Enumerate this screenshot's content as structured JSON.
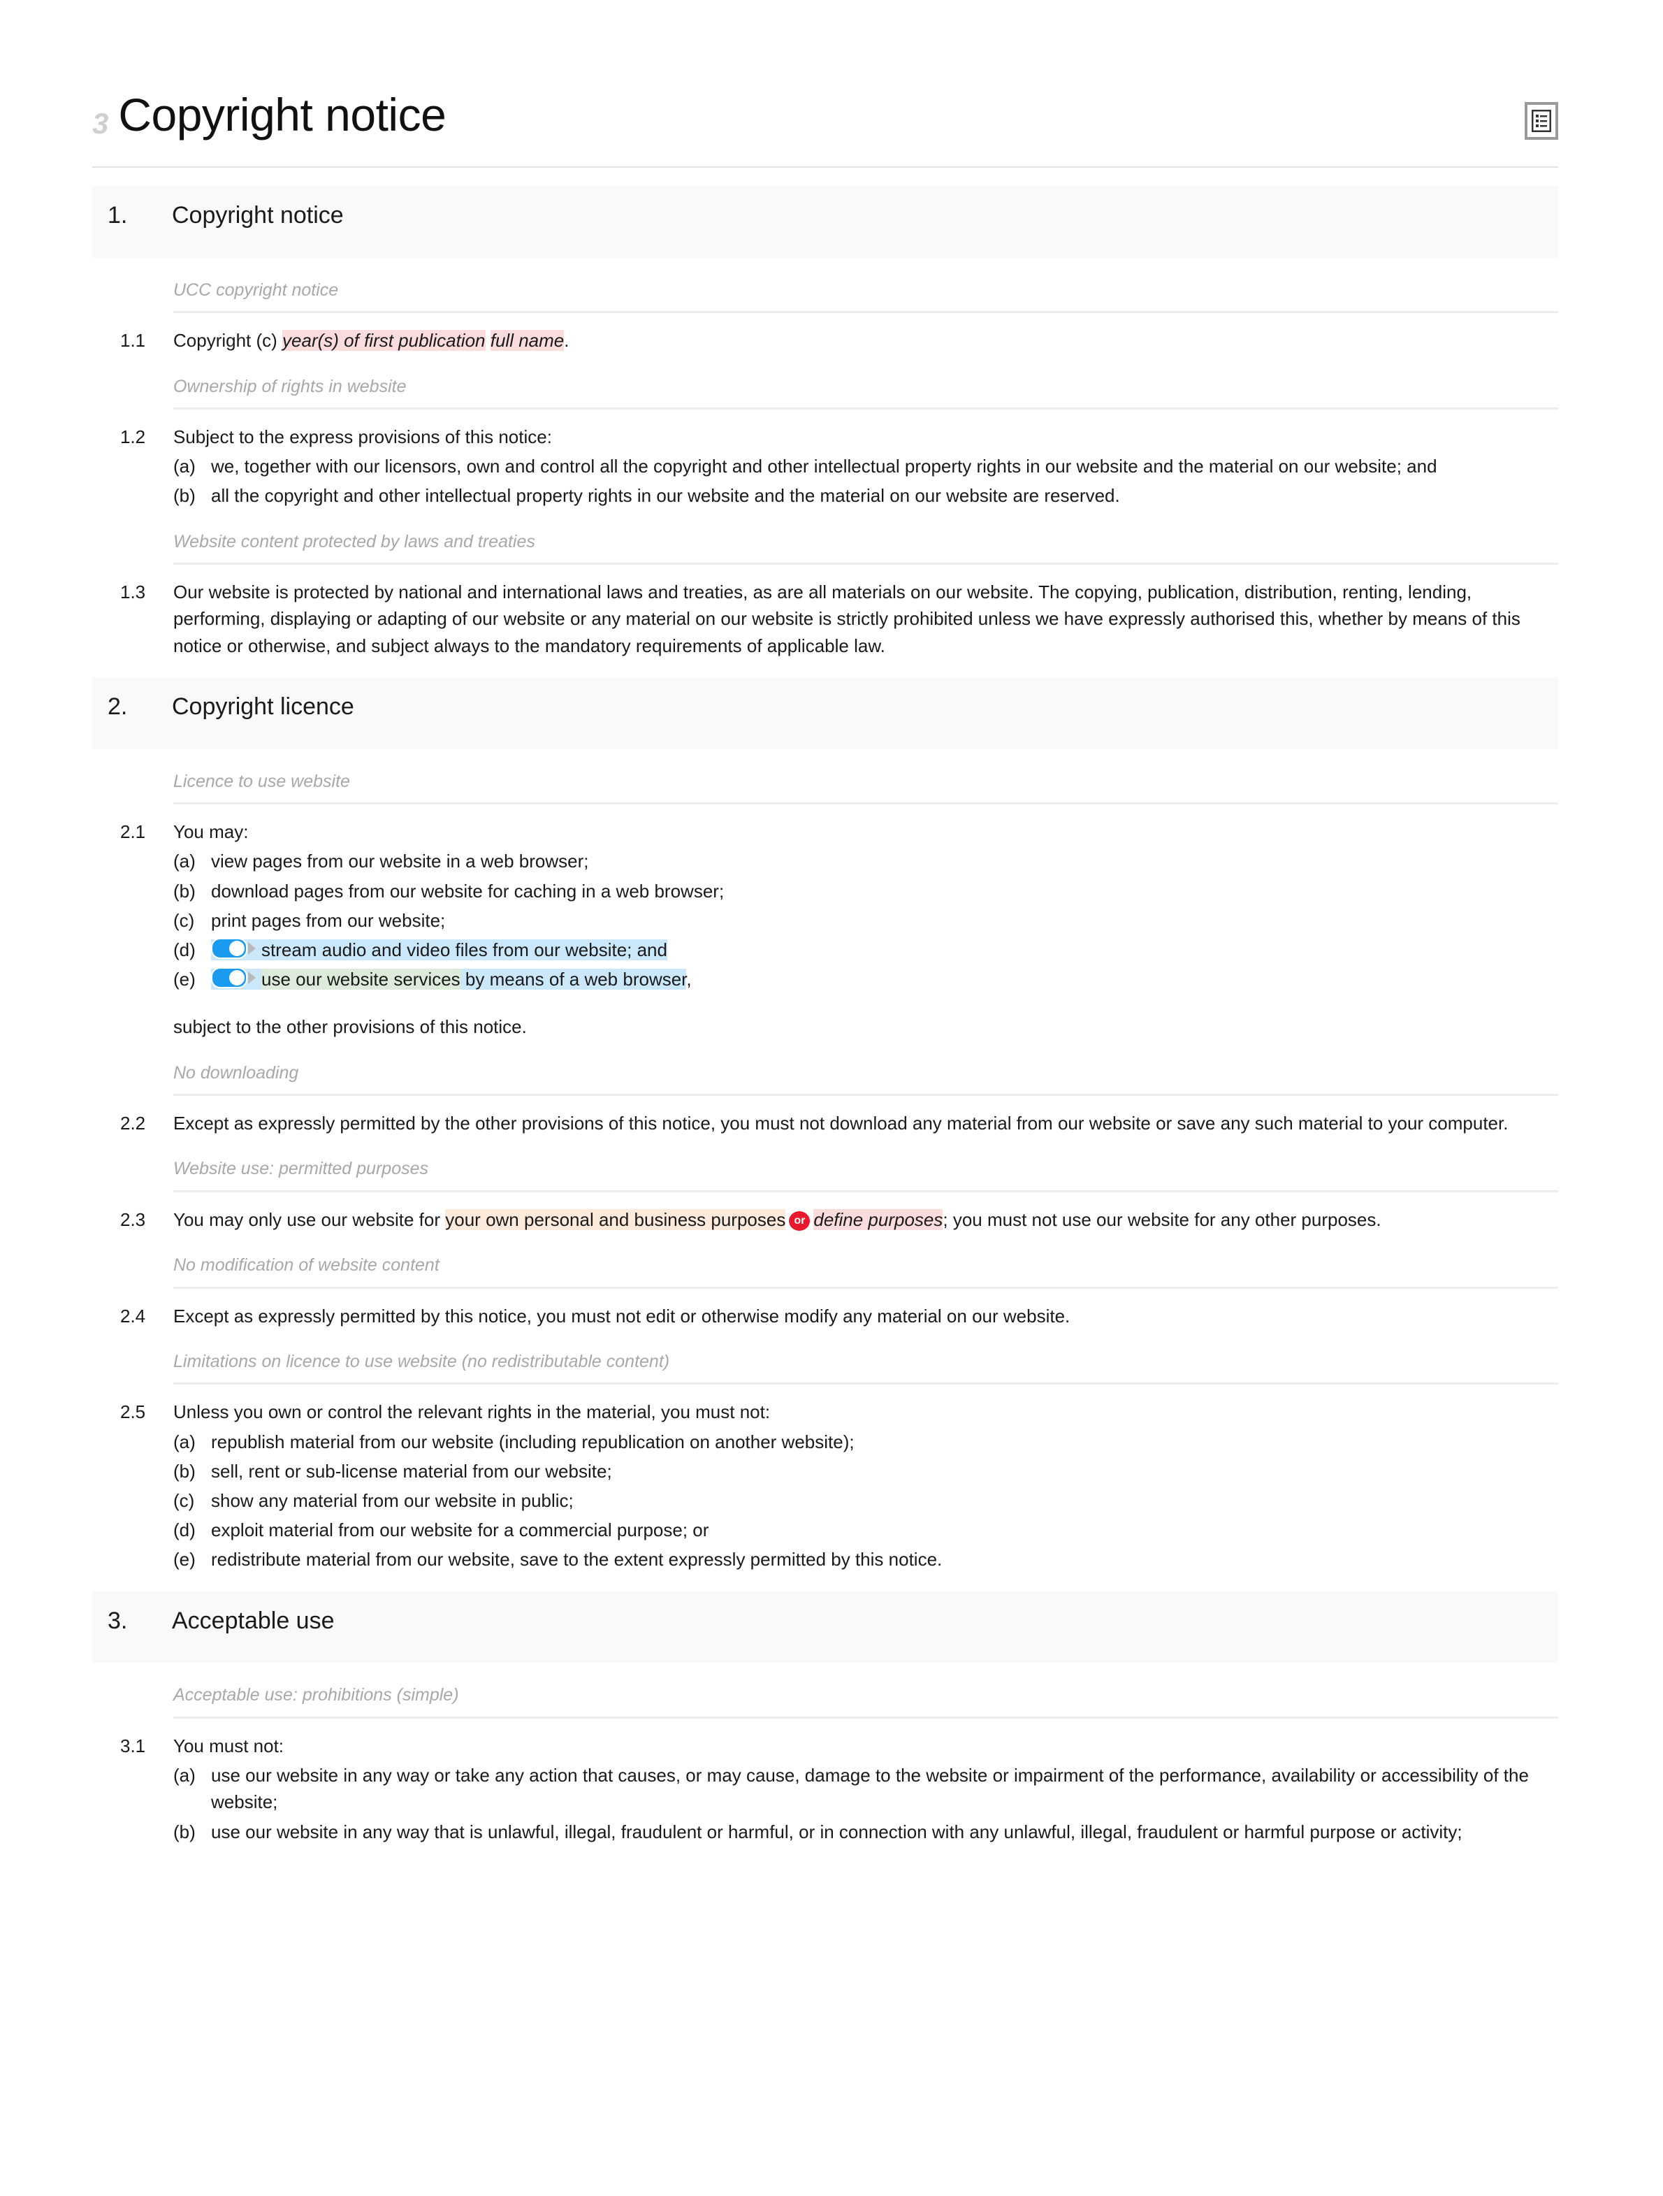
{
  "document": {
    "title": "Copyright notice",
    "doc_mark": "3",
    "header_icon": "document-list-icon"
  },
  "colors": {
    "highlight_pink": "#fbdcdc",
    "highlight_peach": "#fdeada",
    "highlight_green": "#dcebda",
    "highlight_blue": "#cbe7fa",
    "badge_red": "#e8192c",
    "toggle_on": "#1b9bf0",
    "section_band": "#f9f9f9",
    "guidance_text": "#a8a8a8"
  },
  "sections": [
    {
      "number": "1.",
      "title": "Copyright notice",
      "blocks": [
        {
          "guide": "UCC copyright notice",
          "clause_num": "1.1",
          "parts": [
            {
              "type": "text",
              "value": "Copyright (c) "
            },
            {
              "type": "pink",
              "value": "year(s) of first publication"
            },
            {
              "type": "text",
              "value": " "
            },
            {
              "type": "pink",
              "value": "full name"
            },
            {
              "type": "text",
              "value": "."
            }
          ]
        },
        {
          "guide": "Ownership of rights in website",
          "clause_num": "1.2",
          "lead": "Subject to the express provisions of this notice:",
          "sublist": [
            {
              "label": "(a)",
              "text": "we, together with our licensors, own and control all the copyright and other intellectual property rights in our website and the material on our website; and"
            },
            {
              "label": "(b)",
              "text": "all the copyright and other intellectual property rights in our website and the material on our website are reserved."
            }
          ]
        },
        {
          "guide": "Website content protected by laws and treaties",
          "clause_num": "1.3",
          "lead": "Our website is protected by national and international laws and treaties, as are all materials on our website. The copying, publication, distribution, renting, lending, performing, displaying or adapting of our website or any material on our website is strictly prohibited unless we have expressly authorised this, whether by means of this notice or otherwise, and subject always to the mandatory requirements of applicable law."
        }
      ]
    },
    {
      "number": "2.",
      "title": "Copyright licence",
      "blocks": [
        {
          "guide": "Licence to use website",
          "clause_num": "2.1",
          "lead": "You may:",
          "sublist": [
            {
              "label": "(a)",
              "text": "view pages from our website in a web browser;"
            },
            {
              "label": "(b)",
              "text": "download pages from our website for caching in a web browser;"
            },
            {
              "label": "(c)",
              "text": "print pages from our website;"
            },
            {
              "label": "(d)",
              "toggle": true,
              "text": "stream audio and video files from our website; and"
            },
            {
              "label": "(e)",
              "toggle": true,
              "green_text": "use our website services",
              "text_after": " by means of a web browser",
              "tail": ","
            }
          ],
          "trailing": "subject to the other provisions of this notice."
        },
        {
          "guide": "No downloading",
          "clause_num": "2.2",
          "lead": "Except as expressly permitted by the other provisions of this notice, you must not download any material from our website or save any such material to your computer."
        },
        {
          "guide": "Website use: permitted purposes",
          "clause_num": "2.3",
          "parts": [
            {
              "type": "text",
              "value": "You may only use our website for "
            },
            {
              "type": "peach",
              "value": "your own personal and business purposes"
            },
            {
              "type": "badge",
              "value": "or"
            },
            {
              "type": "pink",
              "value": "define purposes"
            },
            {
              "type": "text",
              "value": "; you must not use our website for any other purposes."
            }
          ]
        },
        {
          "guide": "No modification of website content",
          "clause_num": "2.4",
          "lead": "Except as expressly permitted by this notice, you must not edit or otherwise modify any material on our website."
        },
        {
          "guide": "Limitations on licence to use website (no redistributable content)",
          "clause_num": "2.5",
          "lead": "Unless you own or control the relevant rights in the material, you must not:",
          "sublist": [
            {
              "label": "(a)",
              "text": "republish material from our website (including republication on another website);"
            },
            {
              "label": "(b)",
              "text": "sell, rent or sub-license material from our website;"
            },
            {
              "label": "(c)",
              "text": "show any material from our website in public;"
            },
            {
              "label": "(d)",
              "text": "exploit material from our website for a commercial purpose; or"
            },
            {
              "label": "(e)",
              "text": "redistribute material from our website, save to the extent expressly permitted by this notice."
            }
          ]
        }
      ]
    },
    {
      "number": "3.",
      "title": "Acceptable use",
      "blocks": [
        {
          "guide": "Acceptable use: prohibitions (simple)",
          "clause_num": "3.1",
          "lead": "You must not:",
          "sublist": [
            {
              "label": "(a)",
              "text": "use our website in any way or take any action that causes, or may cause, damage to the website or impairment of the performance, availability or accessibility of the website;"
            },
            {
              "label": "(b)",
              "text": "use our website in any way that is unlawful, illegal, fraudulent or harmful, or in connection with any unlawful, illegal, fraudulent or harmful purpose or activity;"
            }
          ]
        }
      ]
    }
  ]
}
